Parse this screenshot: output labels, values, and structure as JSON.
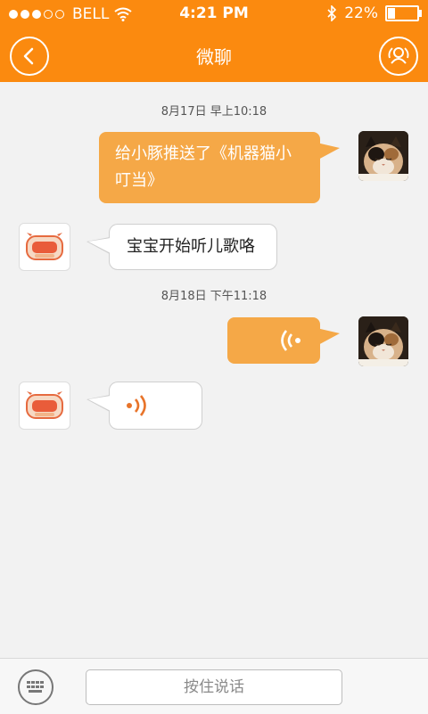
{
  "status_bar": {
    "carrier": "BELL",
    "time": "4:21 PM",
    "battery_percent": "22%",
    "signal_bars_filled": 3,
    "signal_bars_total": 5,
    "icons": [
      "wifi-icon",
      "bluetooth-icon",
      "battery-icon"
    ]
  },
  "navbar": {
    "title": "微聊",
    "back_icon": "chevron-left-icon",
    "right_icon": "contact-profile-icon"
  },
  "colors": {
    "brand_orange": "#fb8a0f",
    "bubble_orange": "#f5a847",
    "background": "#f2f2f2"
  },
  "messages": [
    {
      "type": "timestamp",
      "text": "8月17日 早上10:18"
    },
    {
      "type": "text",
      "side": "right",
      "sender_avatar": "cat-photo",
      "text_line1": "给小豚推送了《机器猫小",
      "text_line2": "叮当》"
    },
    {
      "type": "text",
      "side": "left",
      "sender_avatar": "robot-avatar",
      "text": "宝宝开始听儿歌咯"
    },
    {
      "type": "timestamp",
      "text": "8月18日 下午11:18"
    },
    {
      "type": "voice",
      "side": "right",
      "sender_avatar": "cat-photo",
      "icon": "voice-wave-icon"
    },
    {
      "type": "voice",
      "side": "left",
      "sender_avatar": "robot-avatar",
      "icon": "voice-wave-icon"
    }
  ],
  "input_bar": {
    "keyboard_icon": "keyboard-icon",
    "hold_to_talk_label": "按住说话"
  }
}
